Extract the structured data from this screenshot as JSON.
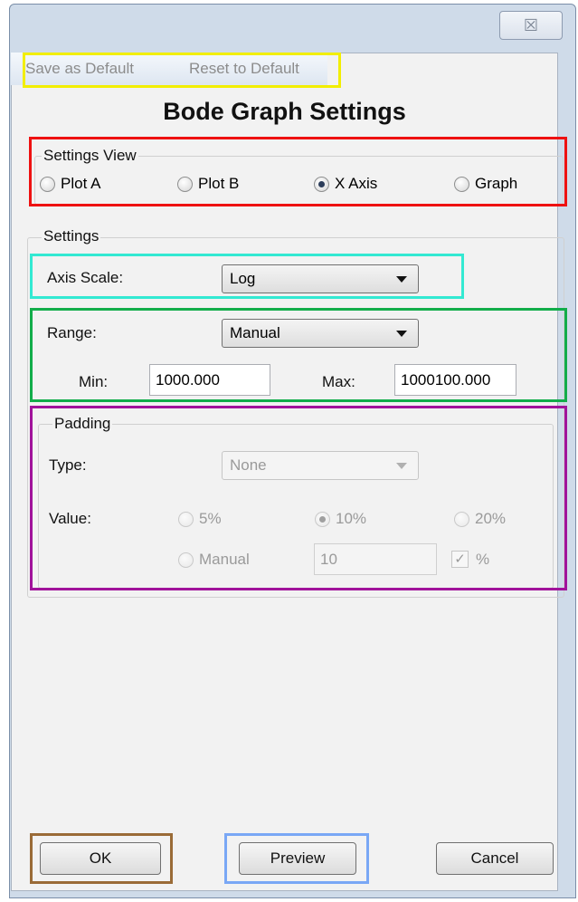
{
  "titlebar": {
    "close_glyph": "☒"
  },
  "menu": {
    "save_default": "Save as Default",
    "reset_default": "Reset to Default"
  },
  "dialog": {
    "title": "Bode Graph Settings"
  },
  "settings_view": {
    "legend": "Settings View",
    "options": [
      "Plot A",
      "Plot B",
      "X Axis",
      "Graph"
    ],
    "selected": "X Axis"
  },
  "settings": {
    "legend": "Settings",
    "axis_scale": {
      "label": "Axis Scale:",
      "value": "Log"
    },
    "range": {
      "label": "Range:",
      "value": "Manual"
    },
    "min": {
      "label": "Min:",
      "value": "1000.000"
    },
    "max": {
      "label": "Max:",
      "value": "1000100.000"
    }
  },
  "padding": {
    "legend": "Padding",
    "type": {
      "label": "Type:",
      "value": "None"
    },
    "value": {
      "label": "Value:",
      "options": [
        "5%",
        "10%",
        "20%",
        "Manual"
      ],
      "selected": "10%",
      "manual_value": "10",
      "percent_label": "%",
      "percent_checked": true
    }
  },
  "buttons": {
    "ok": "OK",
    "preview": "Preview",
    "cancel": "Cancel"
  },
  "highlight_colors": {
    "menu": "#f2ee00",
    "settings_view": "#ee1111",
    "axis_scale": "#33e9d2",
    "range": "#12ad4a",
    "padding": "#a1139b",
    "ok": "#9a6b37",
    "preview": "#79a7f5"
  }
}
